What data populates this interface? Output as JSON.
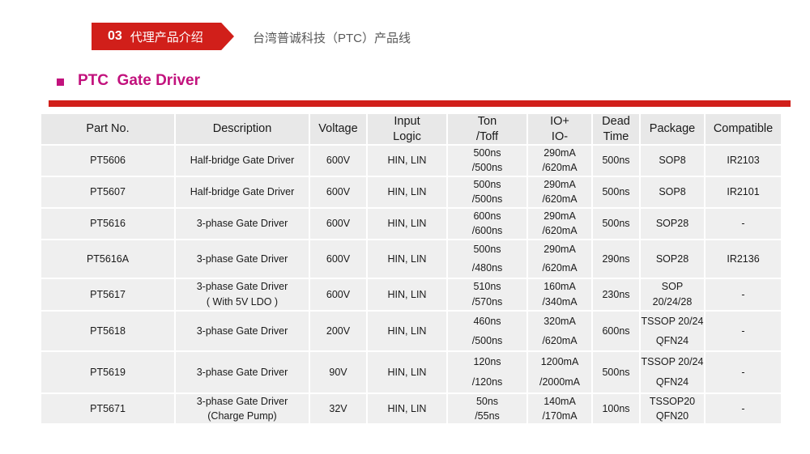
{
  "section": {
    "number": "03",
    "name": "代理产品介绍",
    "subtitle": "台湾普诚科技（PTC）产品线"
  },
  "title": "PTC  Gate Driver",
  "colors": {
    "accent_red": "#d11f1a",
    "title_magenta": "#c2127d",
    "cell_gray": "#efefef"
  },
  "table": {
    "headers": {
      "part": "Part No.",
      "description": "Description",
      "voltage": "Voltage",
      "input_1": "Input",
      "input_2": "Logic",
      "ton_1": "Ton",
      "ton_2": "/Toff",
      "io_1": "IO+",
      "io_2": "IO-",
      "dead_1": "Dead",
      "dead_2": "Time",
      "package": "Package",
      "compatible": "Compatible"
    },
    "rows": [
      {
        "part": "PT5606",
        "desc": "Half-bridge  Gate Driver",
        "voltage": "600V",
        "input": "HIN, LIN",
        "ton": "500ns",
        "toff": "/500ns",
        "io_p": "290mA",
        "io_n": "/620mA",
        "dead": "500ns",
        "package": "SOP8",
        "compatible": "IR2103"
      },
      {
        "part": "PT5607",
        "desc": "Half-bridge Gate Driver",
        "voltage": "600V",
        "input": "HIN, LIN",
        "ton": "500ns",
        "toff": "/500ns",
        "io_p": "290mA",
        "io_n": "/620mA",
        "dead": "500ns",
        "package": "SOP8",
        "compatible": "IR2101"
      },
      {
        "part": "PT5616",
        "desc": "3-phase Gate Driver",
        "voltage": "600V",
        "input": "HIN, LIN",
        "ton": "600ns",
        "toff": "/600ns",
        "io_p": "290mA",
        "io_n": "/620mA",
        "dead": "500ns",
        "package": "SOP28",
        "compatible": "-"
      },
      {
        "part": "PT5616A",
        "desc": "3-phase Gate Driver",
        "voltage": "600V",
        "input": "HIN, LIN",
        "ton": "500ns",
        "toff": "/480ns",
        "io_p": "290mA",
        "io_n": "/620mA",
        "dead": "290ns",
        "package": "SOP28",
        "compatible": "IR2136"
      },
      {
        "part": "PT5617",
        "desc": "3-phase Gate Driver",
        "desc2": "( With 5V LDO )",
        "voltage": "600V",
        "input": "HIN, LIN",
        "ton": "510ns",
        "toff": "/570ns",
        "io_p": "160mA",
        "io_n": "/340mA",
        "dead": "230ns",
        "package": "SOP",
        "package2": "20/24/28",
        "compatible": "-"
      },
      {
        "part": "PT5618",
        "desc": "3-phase Gate Driver",
        "voltage": "200V",
        "input": "HIN, LIN",
        "ton": "460ns",
        "toff": "/500ns",
        "io_p": "320mA",
        "io_n": "/620mA",
        "dead": "600ns",
        "package": "TSSOP 20/24",
        "package2": "QFN24",
        "compatible": "-"
      },
      {
        "part": "PT5619",
        "desc": "3-phase Gate Driver",
        "voltage": "90V",
        "input": "HIN, LIN",
        "ton": "120ns",
        "toff": "/120ns",
        "io_p": "1200mA",
        "io_n": "/2000mA",
        "dead": "500ns",
        "package": "TSSOP 20/24",
        "package2": "QFN24",
        "compatible": "-"
      },
      {
        "part": "PT5671",
        "desc": "3-phase Gate Driver",
        "desc2": "(Charge Pump)",
        "voltage": "32V",
        "input": "HIN, LIN",
        "ton": "50ns",
        "toff": "/55ns",
        "io_p": "140mA",
        "io_n": "/170mA",
        "dead": "100ns",
        "package": "TSSOP20",
        "package2": "QFN20",
        "compatible": "-"
      }
    ]
  }
}
